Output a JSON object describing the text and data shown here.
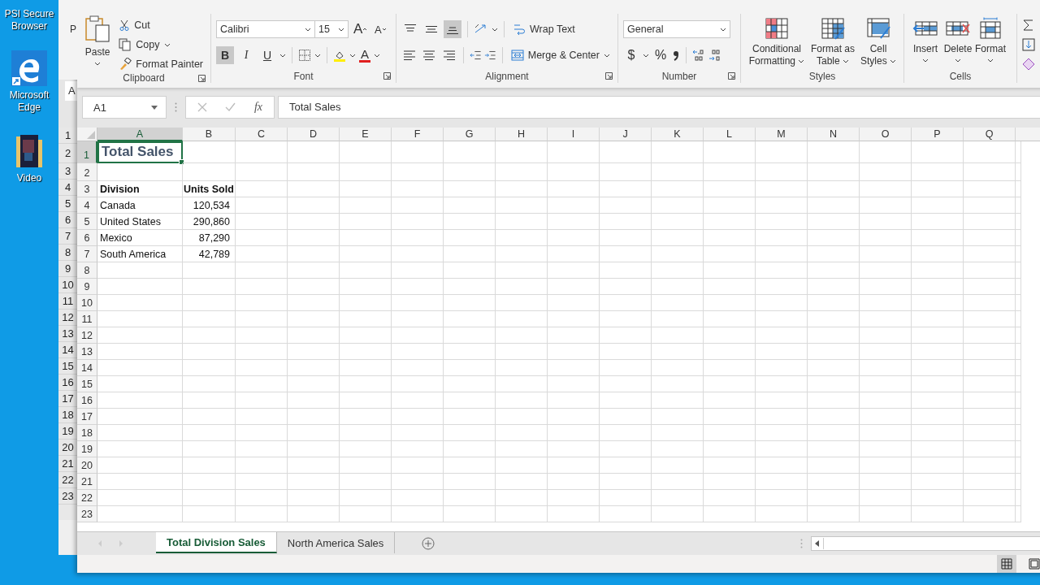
{
  "desktop_icons": [
    {
      "label": "PSI Secure Browser",
      "kind": "app"
    },
    {
      "label": "Microsoft Edge",
      "kind": "edge"
    },
    {
      "label": "Video",
      "kind": "folder"
    }
  ],
  "background_window": {
    "ribbon_fragment": "P",
    "name_box_fragment": "A",
    "row_numbers": [
      "1",
      "2",
      "3",
      "4",
      "5",
      "6",
      "7",
      "8",
      "9",
      "10",
      "11",
      "12",
      "13",
      "14",
      "15",
      "16",
      "17",
      "18",
      "19",
      "20",
      "21",
      "22",
      "23"
    ]
  },
  "window": {
    "ribbon": {
      "clipboard": {
        "label": "Clipboard",
        "paste": "Paste",
        "cut": "Cut",
        "copy": "Copy",
        "format_painter": "Format Painter"
      },
      "font": {
        "label": "Font",
        "font_name": "Calibri",
        "font_size": "15",
        "grow_font": "A",
        "shrink_font": "A",
        "font_color": "A",
        "style_buttons": [
          {
            "label": "B",
            "kind": "bold",
            "on": true
          },
          {
            "label": "I",
            "kind": "italic",
            "on": false
          },
          {
            "label": "U",
            "kind": "underline",
            "on": false
          }
        ]
      },
      "alignment": {
        "label": "Alignment",
        "vertical": [
          {
            "kind": "top",
            "selected": false
          },
          {
            "kind": "middle",
            "selected": false
          },
          {
            "kind": "bottom",
            "selected": true
          }
        ],
        "horizontal": [
          {
            "kind": "left",
            "selected": false
          },
          {
            "kind": "center",
            "selected": false
          },
          {
            "kind": "right",
            "selected": false
          }
        ],
        "wrap_text": "Wrap Text",
        "merge_center": "Merge & Center"
      },
      "number": {
        "label": "Number",
        "format": "General",
        "currency": "$",
        "percent": "%"
      },
      "styles": {
        "label": "Styles",
        "buttons": [
          {
            "label": "Conditional Formatting",
            "kind": "conditional"
          },
          {
            "label": "Format as Table",
            "kind": "table"
          },
          {
            "label": "Cell Styles",
            "kind": "cell"
          }
        ]
      },
      "cells": {
        "label": "Cells",
        "buttons": [
          {
            "label": "Insert",
            "kind": "insert"
          },
          {
            "label": "Delete",
            "kind": "delete"
          },
          {
            "label": "Format",
            "kind": "format"
          }
        ]
      }
    },
    "formula_bar": {
      "name_box": "A1",
      "insert_function": "fx",
      "content": "Total Sales"
    },
    "sheet": {
      "columns": [
        {
          "label": "A",
          "selected": true
        },
        {
          "label": "B",
          "selected": false
        },
        {
          "label": "C",
          "selected": false
        },
        {
          "label": "D",
          "selected": false
        },
        {
          "label": "E",
          "selected": false
        },
        {
          "label": "F",
          "selected": false
        },
        {
          "label": "G",
          "selected": false
        },
        {
          "label": "H",
          "selected": false
        },
        {
          "label": "I",
          "selected": false
        },
        {
          "label": "J",
          "selected": false
        },
        {
          "label": "K",
          "selected": false
        },
        {
          "label": "L",
          "selected": false
        },
        {
          "label": "M",
          "selected": false
        },
        {
          "label": "N",
          "selected": false
        },
        {
          "label": "O",
          "selected": false
        },
        {
          "label": "P",
          "selected": false
        },
        {
          "label": "Q",
          "selected": false
        }
      ],
      "rows": [
        {
          "number": "1",
          "kind": "title",
          "selected": true,
          "cells": [
            "Total Sales"
          ]
        },
        {
          "number": "2",
          "kind": "empty",
          "selected": false
        },
        {
          "number": "3",
          "kind": "header",
          "selected": false,
          "cells": [
            "Division",
            "Units Sold"
          ]
        },
        {
          "number": "4",
          "kind": "data",
          "selected": false,
          "cells": [
            "Canada",
            "120,534"
          ]
        },
        {
          "number": "5",
          "kind": "data",
          "selected": false,
          "cells": [
            "United States",
            "290,860"
          ]
        },
        {
          "number": "6",
          "kind": "data",
          "selected": false,
          "cells": [
            "Mexico",
            "87,290"
          ]
        },
        {
          "number": "7",
          "kind": "data",
          "selected": false,
          "cells": [
            "South America",
            "42,789"
          ]
        },
        {
          "number": "8",
          "kind": "empty",
          "selected": false
        },
        {
          "number": "9",
          "kind": "empty",
          "selected": false
        },
        {
          "number": "10",
          "kind": "empty",
          "selected": false
        },
        {
          "number": "11",
          "kind": "empty",
          "selected": false
        },
        {
          "number": "12",
          "kind": "empty",
          "selected": false
        },
        {
          "number": "13",
          "kind": "empty",
          "selected": false
        },
        {
          "number": "14",
          "kind": "empty",
          "selected": false
        },
        {
          "number": "15",
          "kind": "empty",
          "selected": false
        },
        {
          "number": "16",
          "kind": "empty",
          "selected": false
        },
        {
          "number": "17",
          "kind": "empty",
          "selected": false
        },
        {
          "number": "18",
          "kind": "empty",
          "selected": false
        },
        {
          "number": "19",
          "kind": "empty",
          "selected": false
        },
        {
          "number": "20",
          "kind": "empty",
          "selected": false
        },
        {
          "number": "21",
          "kind": "empty",
          "selected": false
        },
        {
          "number": "22",
          "kind": "empty",
          "selected": false
        },
        {
          "number": "23",
          "kind": "empty",
          "selected": false
        }
      ]
    },
    "sheet_tabs": [
      {
        "label": "Total Division Sales",
        "selected": true
      },
      {
        "label": "North America Sales",
        "selected": false
      }
    ],
    "views": [
      {
        "kind": "normal",
        "selected": true
      },
      {
        "kind": "page_layout",
        "selected": false
      }
    ]
  }
}
